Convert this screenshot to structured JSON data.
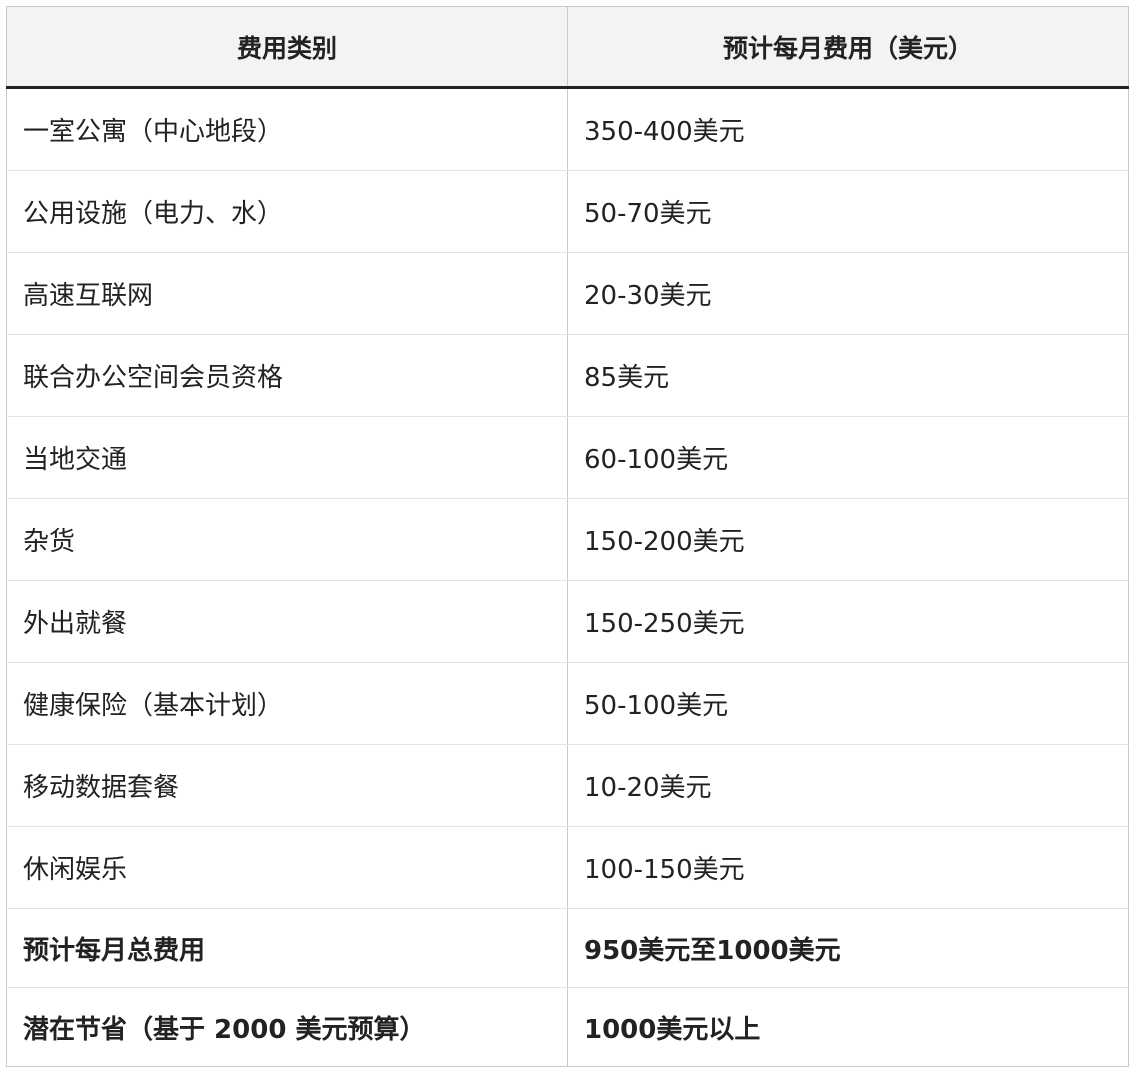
{
  "table": {
    "headers": [
      "费用类别",
      "预计每月费用（美元）"
    ],
    "rows": [
      {
        "category": "一室公寓（中心地段）",
        "cost": "350-400美元"
      },
      {
        "category": "公用设施（电力、水）",
        "cost": "50-70美元"
      },
      {
        "category": "高速互联网",
        "cost": "20-30美元"
      },
      {
        "category": "联合办公空间会员资格",
        "cost": "85美元"
      },
      {
        "category": "当地交通",
        "cost": "60-100美元"
      },
      {
        "category": "杂货",
        "cost": "150-200美元"
      },
      {
        "category": "外出就餐",
        "cost": "150-250美元"
      },
      {
        "category": "健康保险（基本计划）",
        "cost": "50-100美元"
      },
      {
        "category": "移动数据套餐",
        "cost": "10-20美元"
      },
      {
        "category": "休闲娱乐",
        "cost": "100-150美元"
      }
    ],
    "summary_rows": [
      {
        "category": "预计每月总费用",
        "cost": "950美元至1000美元"
      },
      {
        "category": "潜在节省（基于 2000 美元预算）",
        "cost": "1000美元以上"
      }
    ]
  }
}
